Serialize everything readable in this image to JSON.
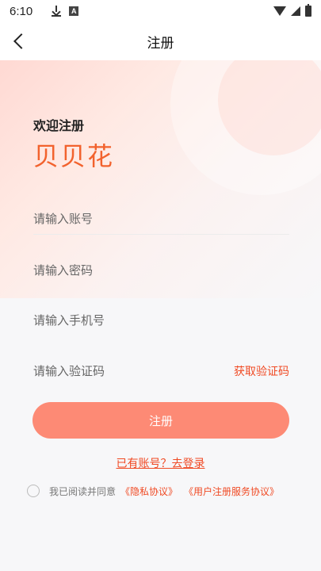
{
  "status_bar": {
    "time": "6:10",
    "icons": [
      "download-icon",
      "a-icon",
      "wifi-icon",
      "signal-icon",
      "battery-icon"
    ]
  },
  "nav": {
    "title": "注册",
    "back_icon": "chevron-left-icon"
  },
  "header": {
    "welcome": "欢迎注册",
    "brand": "贝贝花"
  },
  "form": {
    "account_placeholder": "请输入账号",
    "password_placeholder": "请输入密码",
    "phone_placeholder": "请输入手机号",
    "code_placeholder": "请输入验证码",
    "get_code_label": "获取验证码",
    "submit_label": "注册",
    "login_link": "已有账号？去登录"
  },
  "agreement": {
    "prefix": "我已阅读并同意",
    "privacy_link": "《隐私协议》",
    "service_link": "《用户注册服务协议》"
  },
  "colors": {
    "accent": "#f04a24",
    "button": "#fd8a75",
    "brand": "#f2622d"
  }
}
